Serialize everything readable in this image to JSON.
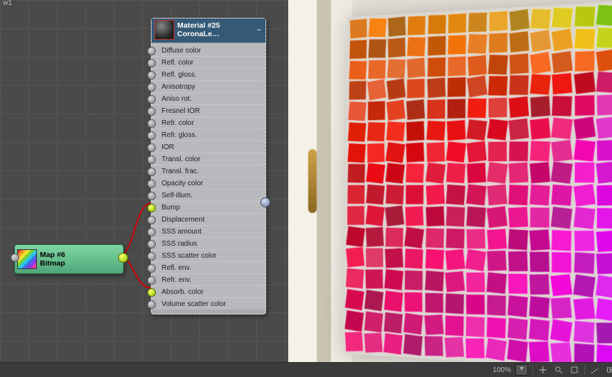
{
  "tab_label": "w1",
  "material": {
    "name": "Material #25",
    "type_label": "CoronaLe…",
    "slots": [
      {
        "label": "Diffuse color",
        "connected": false
      },
      {
        "label": "Refl. color",
        "connected": false
      },
      {
        "label": "Refl. gloss.",
        "connected": false
      },
      {
        "label": "Anisotropy",
        "connected": false
      },
      {
        "label": "Aniso rot.",
        "connected": false
      },
      {
        "label": "Fresnel IOR",
        "connected": false
      },
      {
        "label": "Refr. color",
        "connected": false
      },
      {
        "label": "Refr. gloss.",
        "connected": false
      },
      {
        "label": "IOR",
        "connected": false
      },
      {
        "label": "Transl. color",
        "connected": false
      },
      {
        "label": "Transl. frac.",
        "connected": false
      },
      {
        "label": "Opacity color",
        "connected": false
      },
      {
        "label": "Self-illum.",
        "connected": false
      },
      {
        "label": "Bump",
        "connected": true
      },
      {
        "label": "Displacement",
        "connected": false
      },
      {
        "label": "SSS amount",
        "connected": false
      },
      {
        "label": "SSS radius",
        "connected": false
      },
      {
        "label": "SSS scatter color",
        "connected": false
      },
      {
        "label": "Refl. env.",
        "connected": false
      },
      {
        "label": "Refr. env.",
        "connected": false
      },
      {
        "label": "Absorb. color",
        "connected": true
      },
      {
        "label": "Volume scatter color",
        "connected": false
      }
    ]
  },
  "map_node": {
    "name": "Map #6",
    "type": "Bitmap"
  },
  "wires": [
    {
      "from": "map_out",
      "to_slot_index": 13,
      "color": "#d10000"
    },
    {
      "from": "map_out",
      "to_slot_index": 20,
      "color": "#d10000"
    }
  ],
  "status": {
    "zoom_text": "100%"
  }
}
